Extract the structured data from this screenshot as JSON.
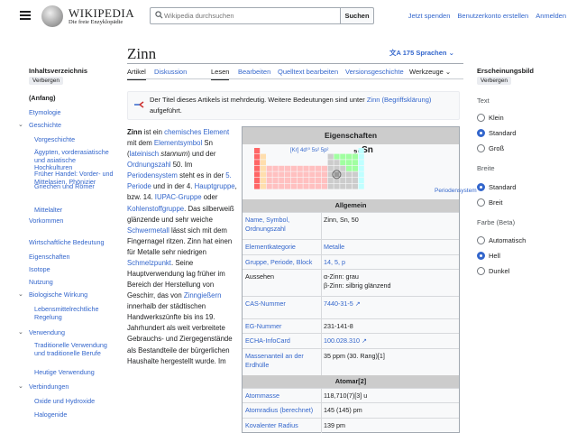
{
  "header": {
    "logo_word": "WIKIPEDIA",
    "logo_tagline": "Die freie Enzyklopädie",
    "search_placeholder": "Wikipedia durchsuchen",
    "search_button": "Suchen",
    "links": [
      "Jetzt spenden",
      "Benutzerkonto erstellen",
      "Anmelden"
    ]
  },
  "article": {
    "title": "Zinn",
    "languages": "175 Sprachen",
    "tabs_left": [
      "Artikel",
      "Diskussion"
    ],
    "tabs_right": [
      "Lesen",
      "Bearbeiten",
      "Quelltext bearbeiten",
      "Versionsgeschichte",
      "Werkzeuge"
    ],
    "notice_prefix": "Der Titel dieses Artikels ist mehrdeutig. Weitere Bedeutungen sind unter",
    "notice_link": "Zinn (Begriffsklärung)",
    "notice_suffix": "aufgeführt."
  },
  "toc": {
    "title": "Inhaltsverzeichnis",
    "hide": "Verbergen",
    "items": [
      {
        "label": "(Anfang)",
        "level": 0,
        "bold": true
      },
      {
        "label": "Etymologie",
        "level": 0
      },
      {
        "label": "Geschichte",
        "level": 0,
        "expanded": true
      },
      {
        "label": "Vorgeschichte",
        "level": 1
      },
      {
        "label": "Ägypten, vorderasiatische und asiatische Hochkulturen",
        "level": 1
      },
      {
        "label": "Früher Handel: Vorder- und Mittelasien, Phönizier",
        "level": 1
      },
      {
        "label": "Griechen und Römer",
        "level": 1
      },
      {
        "label": "Mittelalter",
        "level": 1
      },
      {
        "label": "Vorkommen",
        "level": 0
      },
      {
        "label": "Wirtschaftliche Bedeutung",
        "level": 0
      },
      {
        "label": "Eigenschaften",
        "level": 0
      },
      {
        "label": "Isotope",
        "level": 0
      },
      {
        "label": "Nutzung",
        "level": 0
      },
      {
        "label": "Biologische Wirkung",
        "level": 0,
        "expanded": true
      },
      {
        "label": "Lebensmittelrechtliche Regelung",
        "level": 1
      },
      {
        "label": "Verwendung",
        "level": 0,
        "expanded": true
      },
      {
        "label": "Traditionelle Verwendung und traditionelle Berufe",
        "level": 1
      },
      {
        "label": "Heutige Verwendung",
        "level": 1
      },
      {
        "label": "Verbindungen",
        "level": 0,
        "expanded": true
      },
      {
        "label": "Oxide und Hydroxide",
        "level": 1
      },
      {
        "label": "Halogenide",
        "level": 1
      }
    ]
  },
  "appearance": {
    "title": "Erscheinungsbild",
    "hide": "Verbergen",
    "text_label": "Text",
    "text_options": [
      "Klein",
      "Standard",
      "Groß"
    ],
    "width_label": "Breite",
    "width_options": [
      "Standard",
      "Breit"
    ],
    "color_label": "Farbe (Beta)",
    "color_options": [
      "Automatisch",
      "Hell",
      "Dunkel"
    ]
  },
  "body": {
    "lead_word": "Zinn",
    "parts": [
      {
        "t": " ist ein "
      },
      {
        "t": "chemisches Element",
        "link": true
      },
      {
        "t": " mit dem "
      },
      {
        "t": "Elementsymbol",
        "link": true
      },
      {
        "t": " Sn ("
      },
      {
        "t": "lateinisch",
        "link": true
      },
      {
        "t": " stannum",
        "i": true
      },
      {
        "t": ") und der "
      },
      {
        "t": "Ordnungszahl",
        "link": true
      },
      {
        "t": " 50. Im "
      },
      {
        "t": "Periodensystem",
        "link": true
      },
      {
        "t": " steht es in der "
      },
      {
        "t": "5. Periode",
        "link": true
      },
      {
        "t": " und in der 4. "
      },
      {
        "t": "Hauptgruppe",
        "link": true
      },
      {
        "t": ", bzw. 14. "
      },
      {
        "t": "IUPAC-Gruppe",
        "link": true
      },
      {
        "t": " oder "
      },
      {
        "t": "Kohlenstoffgruppe",
        "link": true
      },
      {
        "t": ". Das silberweiß glänzende und sehr weiche "
      },
      {
        "t": "Schwermetall",
        "link": true
      },
      {
        "t": " lässt sich mit dem Fingernagel ritzen. Zinn hat einen für Metalle sehr niedrigen "
      },
      {
        "t": "Schmelzpunkt",
        "link": true
      },
      {
        "t": ". Seine Hauptverwendung lag früher im Bereich der Herstellung von Geschirr, das von "
      },
      {
        "t": "Zinngießern",
        "link": true
      },
      {
        "t": " innerhalb der städtischen Handwerkszünfte bis ins 19. Jahrhundert als weit verbreitete Gebrauchs- und Ziergegenstände als Bestandteile der bürgerlichen Haushalte hergestellt wurde. Im"
      }
    ]
  },
  "infobox": {
    "title": "Eigenschaften",
    "pt_label": "[Kr] 4d¹⁰ 5s² 5p²",
    "pt_symbol": "₅₀Sn",
    "pt_link": "Periodensystem",
    "sec_general": "Allgemein",
    "rows_general": [
      {
        "k": "Name, Symbol, Ordnungszahl",
        "v": "Zinn, Sn, 50"
      },
      {
        "k": "Elementkategorie",
        "v": "Metalle",
        "vlink": true
      },
      {
        "k": "Gruppe, Periode, Block",
        "v": "14, 5, p",
        "vlink": true
      },
      {
        "k": "Aussehen",
        "v": "α-Zinn: grau\nβ-Zinn: silbrig glänzend",
        "kplain": true
      },
      {
        "k": "CAS-Nummer",
        "v": "7440-31-5 ↗",
        "vlink": true
      },
      {
        "k": "EG-Nummer",
        "v": "231-141-8"
      },
      {
        "k": "ECHA-InfoCard",
        "v": "100.028.310 ↗",
        "vlink": true
      },
      {
        "k": "Massenanteil an der Erdhülle",
        "v": "35 ppm (30. Rang)[1]"
      }
    ],
    "sec_atom": "Atomar[2]",
    "rows_atom": [
      {
        "k": "Atommasse",
        "v": "118,710(7)[3] u"
      },
      {
        "k": "Atomradius (berechnet)",
        "v": "145 (145) pm"
      },
      {
        "k": "Kovalenter Radius",
        "v": "139 pm"
      }
    ]
  }
}
